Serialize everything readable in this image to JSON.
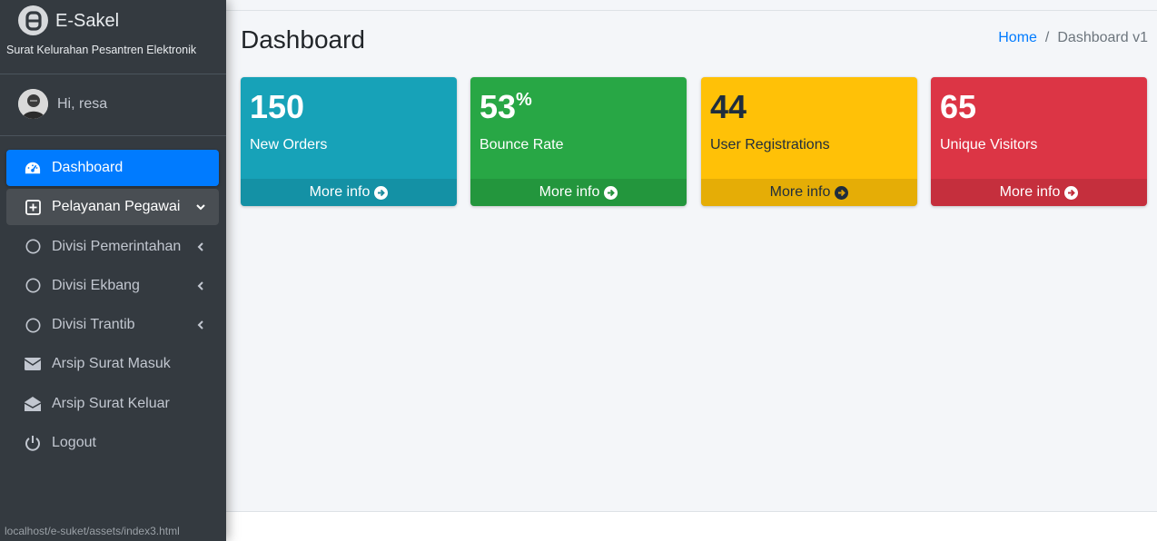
{
  "brand": {
    "title": "E-Sakel",
    "subtitle": "Surat Kelurahan Pesantren Elektronik"
  },
  "user": {
    "greeting": "Hi, resa"
  },
  "nav": [
    {
      "label": "Dashboard",
      "icon": "tachometer-icon",
      "state": "active"
    },
    {
      "label": "Pelayanan Pegawai",
      "icon": "plus-square-icon",
      "state": "open",
      "chevron": "down"
    },
    {
      "label": "Divisi Pemerintahan",
      "icon": "circle-icon",
      "chevron": "left"
    },
    {
      "label": "Divisi Ekbang",
      "icon": "circle-icon",
      "chevron": "left"
    },
    {
      "label": "Divisi Trantib",
      "icon": "circle-icon",
      "chevron": "left"
    },
    {
      "label": "Arsip Surat Masuk",
      "icon": "envelope-icon"
    },
    {
      "label": "Arsip Surat Keluar",
      "icon": "envelope-open-icon"
    },
    {
      "label": "Logout",
      "icon": "power-icon"
    }
  ],
  "page": {
    "title": "Dashboard"
  },
  "breadcrumb": {
    "home": "Home",
    "separator": "/",
    "current": "Dashboard v1"
  },
  "boxes": [
    {
      "value": "150",
      "suffix": "",
      "label": "New Orders",
      "footer": "More info",
      "color": "#17a2b8",
      "text_color": "#ffffff"
    },
    {
      "value": "53",
      "suffix": "%",
      "label": "Bounce Rate",
      "footer": "More info",
      "color": "#28a745",
      "text_color": "#ffffff"
    },
    {
      "value": "44",
      "suffix": "",
      "label": "User Registrations",
      "footer": "More info",
      "color": "#ffc107",
      "text_color": "#1f2d3d"
    },
    {
      "value": "65",
      "suffix": "",
      "label": "Unique Visitors",
      "footer": "More info",
      "color": "#dc3545",
      "text_color": "#ffffff"
    }
  ],
  "statusbar": {
    "url": "localhost/e-suket/assets/index3.html"
  }
}
